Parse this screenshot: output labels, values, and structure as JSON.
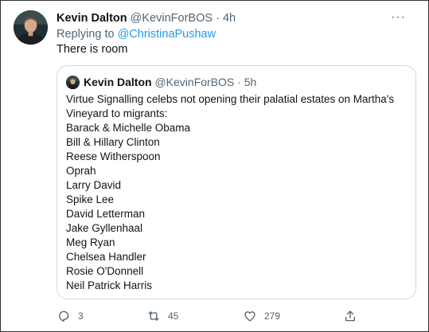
{
  "tweet": {
    "author_name": "Kevin Dalton",
    "author_handle": "@KevinForBOS",
    "separator": "·",
    "time": "4h",
    "more_label": "···",
    "replying_prefix": "Replying to",
    "replying_to": "@ChristinaPushaw",
    "text": "There is room"
  },
  "quoted": {
    "author_name": "Kevin Dalton",
    "author_handle": "@KevinForBOS",
    "separator": "·",
    "time": "5h",
    "lines": [
      "Virtue Signalling celebs not opening their palatial estates on Martha's",
      "Vineyard to migrants:",
      "Barack & Michelle Obama",
      "Bill & Hillary Clinton",
      "Reese Witherspoon",
      "Oprah",
      "Larry David",
      "Spike Lee",
      "David Letterman",
      "Jake Gyllenhaal",
      "Meg Ryan",
      "Chelsea Handler",
      "Rosie O'Donnell",
      "Neil Patrick Harris"
    ]
  },
  "actions": {
    "reply": {
      "icon": "reply-icon",
      "count": "3"
    },
    "retweet": {
      "icon": "retweet-icon",
      "count": "45"
    },
    "like": {
      "icon": "heart-icon",
      "count": "279"
    },
    "share": {
      "icon": "share-icon"
    }
  },
  "colors": {
    "text": "#0f1419",
    "secondary": "#536471",
    "link": "#1d9bf0",
    "border": "#cfd9de"
  }
}
